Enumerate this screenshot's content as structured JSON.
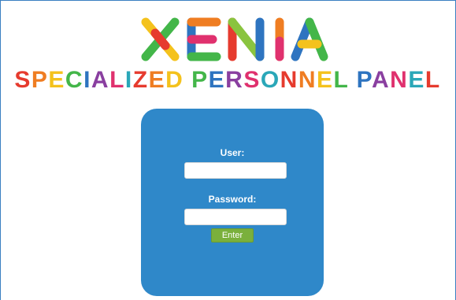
{
  "logo": {
    "title_letters": [
      "X",
      "E",
      "N",
      "I",
      "A"
    ],
    "subtitle": "SPECIALIZED PERSONNEL PANEL"
  },
  "login": {
    "user_label": "User:",
    "user_value": "",
    "password_label": "Password:",
    "password_value": "",
    "enter_label": "Enter"
  },
  "colors": {
    "panel": "#2f88c9",
    "button": "#7ab03c",
    "frame": "#3a7fc1"
  }
}
